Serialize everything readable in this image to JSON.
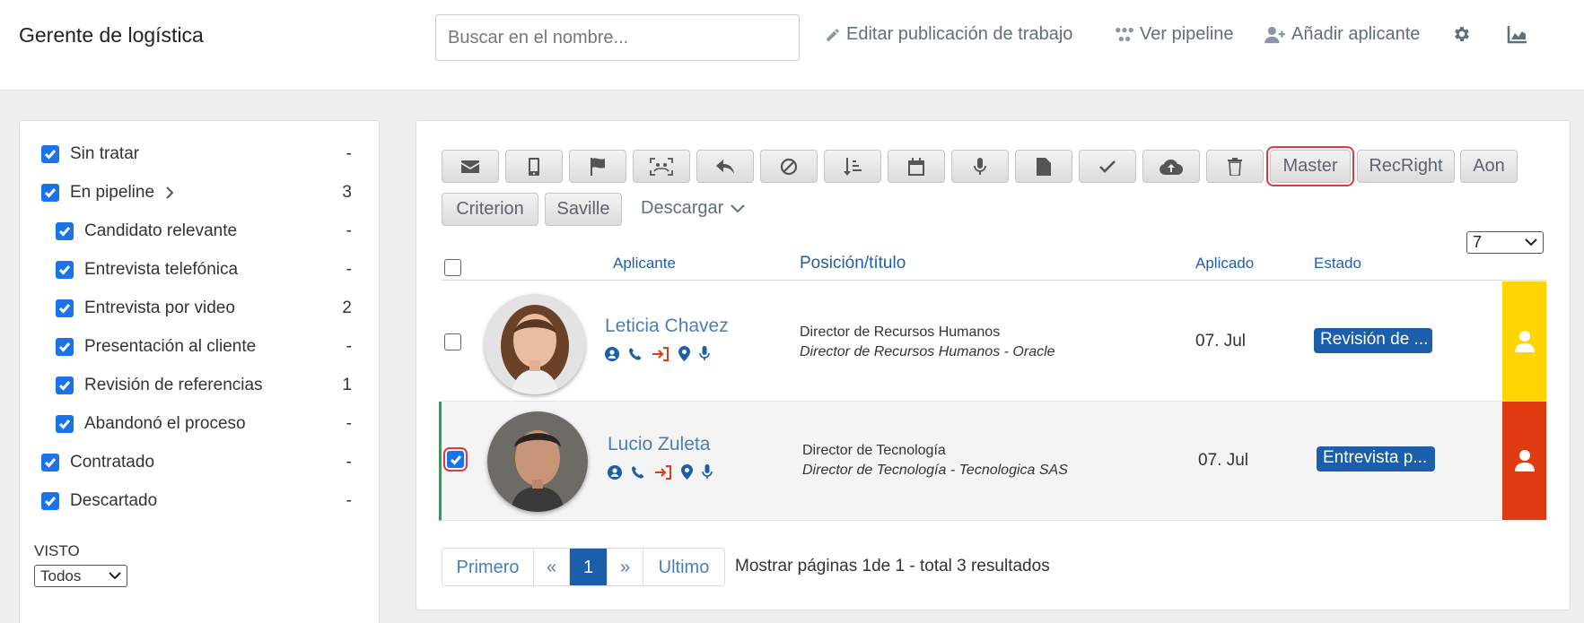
{
  "header": {
    "title": "Gerente de logística",
    "search_placeholder": "Buscar en el nombre...",
    "edit_label": "Editar publicación de trabajo",
    "pipeline_label": "Ver pipeline",
    "add_label": "Añadir aplicante"
  },
  "sidebar": {
    "items": [
      {
        "label": "Sin tratar",
        "count": "-"
      },
      {
        "label": "En pipeline",
        "count": "3"
      },
      {
        "label": "Candidato relevante",
        "count": "-"
      },
      {
        "label": "Entrevista telefónica",
        "count": "-"
      },
      {
        "label": "Entrevista por video",
        "count": "2"
      },
      {
        "label": "Presentación al cliente",
        "count": "-"
      },
      {
        "label": "Revisión de referencias",
        "count": "1"
      },
      {
        "label": "Abandonó el proceso",
        "count": "-"
      },
      {
        "label": "Contratado",
        "count": "-"
      },
      {
        "label": "Descartado",
        "count": "-"
      }
    ],
    "visto_label": "VISTO",
    "visto_value": "Todos"
  },
  "toolbar": {
    "icon_buttons": [
      "envelope-icon",
      "mobile-icon",
      "flag-icon",
      "face-scan-icon",
      "reply-icon",
      "ban-icon",
      "sort-icon",
      "calendar-icon",
      "microphone-icon",
      "file-icon",
      "check-icon",
      "cloud-upload-icon",
      "trash-icon"
    ],
    "text_buttons": [
      "Master",
      "RecRight",
      "Aon",
      "Criterion",
      "Saville"
    ],
    "download_label": "Descargar",
    "per_page": "7"
  },
  "table": {
    "headers": {
      "applicant": "Aplicante",
      "position": "Posición/título",
      "applied": "Aplicado",
      "status": "Estado"
    },
    "rows": [
      {
        "name": "Leticia Chavez",
        "position": "Director de Recursos Humanos",
        "subtitle": "Director de Recursos Humanos - Oracle",
        "applied": "07. Jul",
        "status": "Revisión de ...",
        "checked": false,
        "bar_color": "#ffd400"
      },
      {
        "name": "Lucio Zuleta",
        "position": "Director de Tecnología",
        "subtitle": "Director de Tecnología - Tecnologica SAS",
        "applied": "07. Jul",
        "status": "Entrevista p...",
        "checked": true,
        "bar_color": "#e03a12"
      }
    ]
  },
  "pagination": {
    "first": "Primero",
    "prev": "«",
    "current": "1",
    "next": "»",
    "last": "Ultimo",
    "info_prefix": "Mostrar páginas ",
    "info_page": "1",
    "info_of": "de ",
    "info_total_pages": "1",
    "info_total": " - total ",
    "info_count": "3",
    "info_suffix": " resultados"
  },
  "colors": {
    "accent": "#1b5ea9",
    "link": "#4a7fb5",
    "checkbox": "#1a73e8",
    "highlight": "#e0393e",
    "selected_border": "#22a84a"
  }
}
